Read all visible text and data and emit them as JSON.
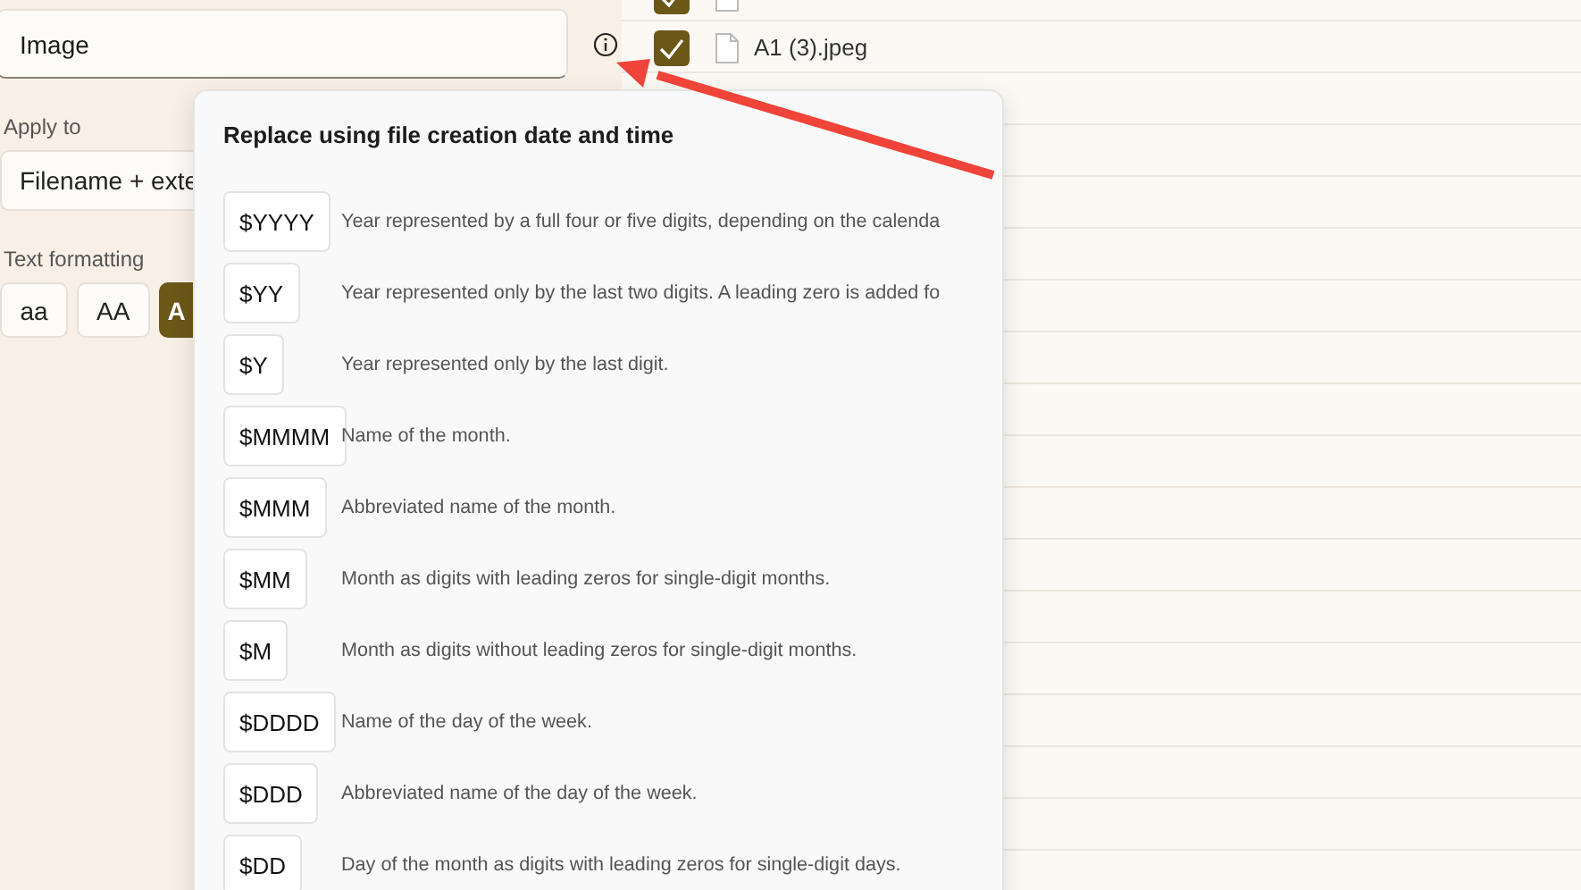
{
  "name_field": {
    "value": "Image"
  },
  "apply_to": {
    "label": "Apply to",
    "value": "Filename + exte"
  },
  "text_formatting": {
    "label": "Text formatting",
    "options": [
      {
        "label": "aa",
        "selected": false
      },
      {
        "label": "AA",
        "selected": false
      },
      {
        "label": "A",
        "selected": true
      }
    ]
  },
  "files": [
    {
      "checked": true
    },
    {
      "name": "A1 (3).jpeg",
      "checked": true
    }
  ],
  "popup": {
    "title": "Replace using file creation date and time",
    "patterns": [
      {
        "code": "$YYYY",
        "description": "Year represented by a full four or five digits, depending on the calenda"
      },
      {
        "code": "$YY",
        "description": "Year represented only by the last two digits. A leading zero is added fo"
      },
      {
        "code": "$Y",
        "description": "Year represented only by the last digit."
      },
      {
        "code": "$MMMM",
        "description": "Name of the month."
      },
      {
        "code": "$MMM",
        "description": "Abbreviated name of the month."
      },
      {
        "code": "$MM",
        "description": "Month as digits with leading zeros for single-digit months."
      },
      {
        "code": "$M",
        "description": "Month as digits without leading zeros for single-digit months."
      },
      {
        "code": "$DDDD",
        "description": "Name of the day of the week."
      },
      {
        "code": "$DDD",
        "description": "Abbreviated name of the day of the week."
      },
      {
        "code": "$DD",
        "description": "Day of the month as digits with leading zeros for single-digit days."
      }
    ]
  }
}
